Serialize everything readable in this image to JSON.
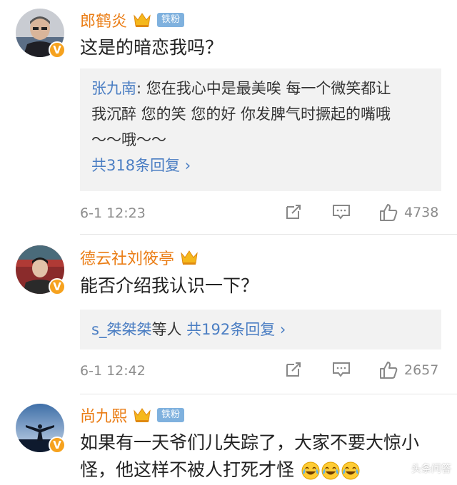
{
  "comments": [
    {
      "name": "郎鹤炎",
      "fan_badge": "铁粉",
      "text": "这是的暗恋我吗？",
      "reply": {
        "author": "张九南",
        "line1": ": 您在我心中是最美唉 每一个微笑都让",
        "line2": "我沉醉 您的笑 您的好 你发脾气时撅起的嘴哦",
        "line3": "～～哦～～",
        "link": "共318条回复 ›"
      },
      "time": "6-1 12:23",
      "likes": "4738"
    },
    {
      "name": "德云社刘筱亭",
      "text": "能否介绍我认识一下？",
      "reply": {
        "author": "s_桀桀桀",
        "suffix": "等人 ",
        "link": "共192条回复 ›"
      },
      "time": "6-1 12:42",
      "likes": "2657"
    },
    {
      "name": "尚九熙",
      "fan_badge": "铁粉",
      "text_line1": "如果有一天爷们儿失踪了，大家不要大惊小",
      "text_line2": "怪，他这样不被人打死才怪"
    }
  ],
  "watermark": "头条问答",
  "colors": {
    "name": "#ea7d15",
    "link": "#4b7ec3",
    "badge_v": "#f6a21e",
    "fan_badge": "#7fb1de"
  }
}
